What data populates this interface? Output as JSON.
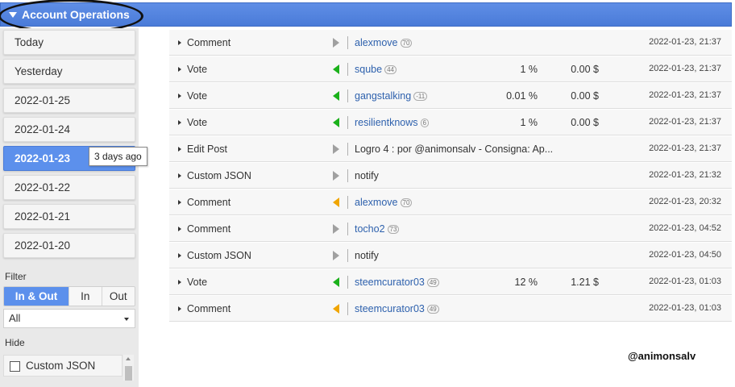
{
  "header": {
    "title": "Account Operations"
  },
  "sidebar": {
    "days": [
      "Today",
      "Yesterday",
      "2022-01-25",
      "2022-01-24",
      "2022-01-23",
      "2022-01-22",
      "2022-01-21",
      "2022-01-20"
    ],
    "active_day": "2022-01-23",
    "tooltip": "3 days ago",
    "filter_label": "Filter",
    "filter_options": [
      "In & Out",
      "In",
      "Out"
    ],
    "filter_selected": "In & Out",
    "type_select": "All",
    "hide_label": "Hide",
    "hide_items": [
      "Custom JSON"
    ]
  },
  "operations": [
    {
      "type": "Comment",
      "direction": "gray",
      "target": "alexmove",
      "rep": "70",
      "link": true,
      "pct": "",
      "amount": "",
      "time": "2022-01-23, 21:37"
    },
    {
      "type": "Vote",
      "direction": "green",
      "target": "sqube",
      "rep": "44",
      "link": true,
      "pct": "1 %",
      "amount": "0.00 $",
      "time": "2022-01-23, 21:37"
    },
    {
      "type": "Vote",
      "direction": "green",
      "target": "gangstalking",
      "rep": "-11",
      "link": true,
      "pct": "0.01 %",
      "amount": "0.00 $",
      "time": "2022-01-23, 21:37"
    },
    {
      "type": "Vote",
      "direction": "green",
      "target": "resilientknows",
      "rep": "6",
      "link": true,
      "pct": "1 %",
      "amount": "0.00 $",
      "time": "2022-01-23, 21:37"
    },
    {
      "type": "Edit Post",
      "direction": "gray",
      "target": "Logro 4 : por @animonsalv - Consigna: Ap...",
      "rep": "",
      "link": false,
      "pct": "",
      "amount": "",
      "time": "2022-01-23, 21:37"
    },
    {
      "type": "Custom JSON",
      "direction": "gray",
      "target": "notify",
      "rep": "",
      "link": false,
      "pct": "",
      "amount": "",
      "time": "2022-01-23, 21:32"
    },
    {
      "type": "Comment",
      "direction": "orange",
      "target": "alexmove",
      "rep": "70",
      "link": true,
      "pct": "",
      "amount": "",
      "time": "2022-01-23, 20:32"
    },
    {
      "type": "Comment",
      "direction": "gray",
      "target": "tocho2",
      "rep": "73",
      "link": true,
      "pct": "",
      "amount": "",
      "time": "2022-01-23, 04:52"
    },
    {
      "type": "Custom JSON",
      "direction": "gray",
      "target": "notify",
      "rep": "",
      "link": false,
      "pct": "",
      "amount": "",
      "time": "2022-01-23, 04:50"
    },
    {
      "type": "Vote",
      "direction": "green",
      "target": "steemcurator03",
      "rep": "49",
      "link": true,
      "pct": "12 %",
      "amount": "1.21 $",
      "time": "2022-01-23, 01:03"
    },
    {
      "type": "Comment",
      "direction": "orange",
      "target": "steemcurator03",
      "rep": "49",
      "link": true,
      "pct": "",
      "amount": "",
      "time": "2022-01-23, 01:03"
    }
  ],
  "signature": "@animonsalv",
  "colors": {
    "header": "#4a7bd8",
    "active": "#5c90ec",
    "link": "#2e61ad",
    "vote_in": "#1bb11b",
    "comment_in": "#f0a500"
  }
}
